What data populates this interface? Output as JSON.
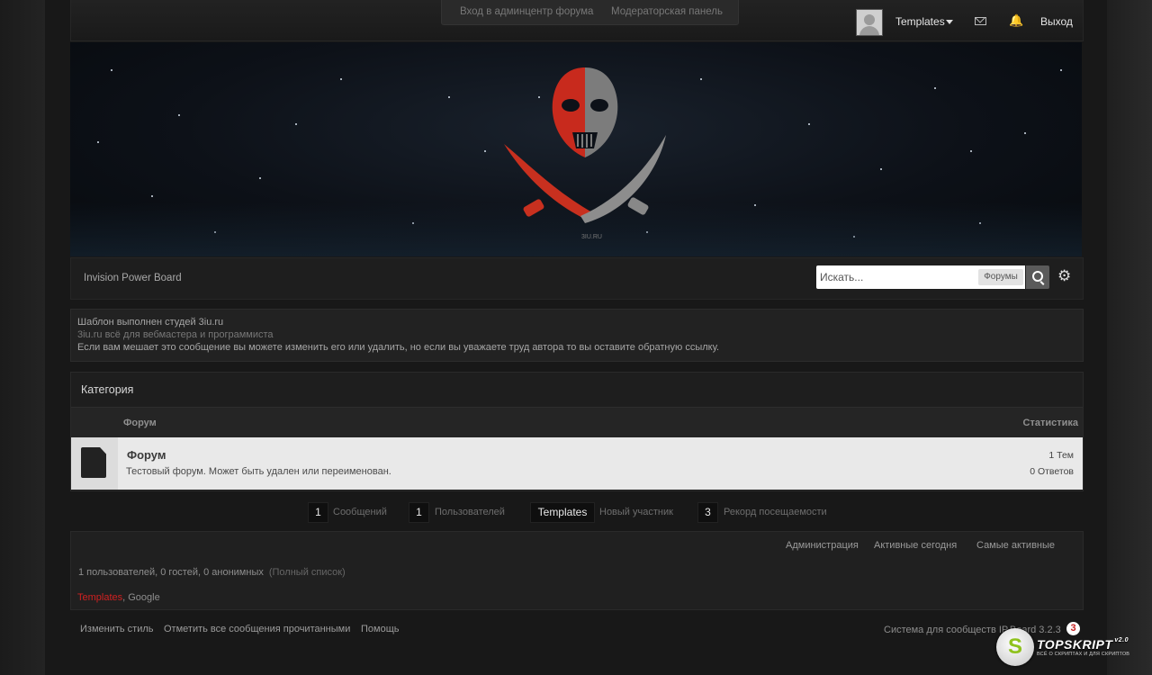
{
  "topbar": {
    "admin_links": [
      "Вход в админцентр форума",
      "Модераторская панель"
    ],
    "user_name": "Templates",
    "logout": "Выход"
  },
  "banner": {
    "watermark": "3IU.RU"
  },
  "navbar": {
    "breadcrumb": "Invision Power Board",
    "search_placeholder": "Искать...",
    "search_scope": "Форумы"
  },
  "notice": {
    "line1": "Шаблон выполнен студей 3iu.ru",
    "line2": "3iu.ru всё для вебмастера и программиста",
    "line3": "Если вам мешает это сообщение вы можете изменить его или удалить, но если вы уважаете труд автора то вы оставите обратную ссылку."
  },
  "category": {
    "title": "Категория",
    "col_forum": "Форум",
    "col_stats": "Статистика",
    "forum": {
      "name": "Форум",
      "description": "Тестовый форум. Может быть удален или переименован.",
      "topics": "1 Тем",
      "replies": "0 Ответов"
    }
  },
  "stats": [
    {
      "value": "1",
      "label": "Сообщений"
    },
    {
      "value": "1",
      "label": "Пользователей"
    },
    {
      "value": "Templates",
      "label": "Новый участник"
    },
    {
      "value": "3",
      "label": "Рекорд посещаемости"
    }
  ],
  "online": {
    "links": [
      "Администрация",
      "Активные сегодня",
      "Самые активные"
    ],
    "count_text": "1 пользователей, 0 гостей, 0 анонимных",
    "full_list": "(Полный список)",
    "user_red": "Templates",
    "user_other": ", Google"
  },
  "footer": {
    "links": [
      "Изменить стиль",
      "Отметить все сообщения прочитанными",
      "Помощь"
    ],
    "copyright": "Система для сообществ IP.Board 3.2.3",
    "badge": "3"
  },
  "topskript": {
    "letter": "S",
    "title": "TOPSKRIPT",
    "version": "v2.0",
    "subtitle": "ВСЁ О СКРИПТАХ И ДЛЯ СКРИПТОВ"
  },
  "colors": {
    "background": "#151515",
    "accent_red": "#d12020",
    "forum_row": "#e9e9e9"
  }
}
